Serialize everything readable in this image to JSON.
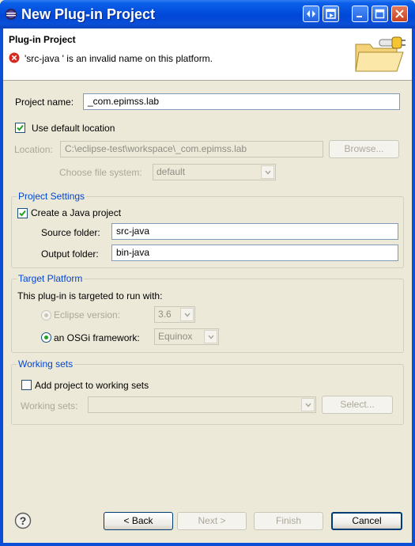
{
  "window": {
    "title": "New Plug-in Project"
  },
  "header": {
    "title": "Plug-in Project",
    "error_message": "'src-java ' is an invalid name on this platform."
  },
  "project": {
    "name_label": "Project name:",
    "name_value": "_com.epimss.lab",
    "use_default_label": "Use default location",
    "use_default_checked": true,
    "location_label": "Location:",
    "location_value": "C:\\eclipse-test\\workspace\\_com.epimss.lab",
    "browse_label": "Browse...",
    "filesystem_label": "Choose file system:",
    "filesystem_value": "default"
  },
  "project_settings": {
    "title": "Project Settings",
    "java_label": "Create a Java project",
    "java_checked": true,
    "source_label": "Source folder:",
    "source_value": "src-java",
    "output_label": "Output folder:",
    "output_value": "bin-java"
  },
  "target_platform": {
    "title": "Target Platform",
    "intro": "This plug-in is targeted to run with:",
    "eclipse_label": "Eclipse version:",
    "eclipse_value": "3.6",
    "osgi_label": "an OSGi framework:",
    "osgi_value": "Equinox",
    "selected": "osgi"
  },
  "working_sets": {
    "title": "Working sets",
    "add_label": "Add project to working sets",
    "add_checked": false,
    "sets_label": "Working sets:",
    "sets_value": "",
    "select_label": "Select..."
  },
  "footer": {
    "back_label": "< Back",
    "next_label": "Next >",
    "finish_label": "Finish",
    "cancel_label": "Cancel"
  },
  "colors": {
    "titlebar": "#0a4fd6",
    "group_title": "#0046d5",
    "error": "#d7281e"
  }
}
